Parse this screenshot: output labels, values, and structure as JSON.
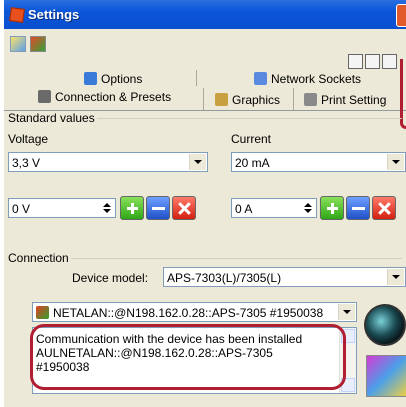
{
  "window": {
    "title": "Settings"
  },
  "tabs": [
    {
      "label": "Options",
      "icon": "options-icon"
    },
    {
      "label": "Network Sockets",
      "icon": "network-sockets-icon"
    },
    {
      "label": "Connection & Presets",
      "icon": "connection-icon"
    },
    {
      "label": "Graphics",
      "icon": "graphics-icon"
    },
    {
      "label": "Print Setting",
      "icon": "print-icon"
    }
  ],
  "standard_values": {
    "group_title": "Standard values",
    "voltage_label": "Voltage",
    "voltage_value": "3,3 V",
    "voltage_spin_value": "0 V",
    "current_label": "Current",
    "current_value": "20 mA",
    "current_spin_value": "0 A"
  },
  "connection": {
    "group_title": "Connection",
    "device_model_label": "Device model:",
    "device_model_value": "APS-7303(L)/7305(L)",
    "device_address": "NETALAN::@N198.162.0.28::APS-7305 #1950038",
    "status_text": "Communication with the device has been installed\nAULNETALAN::@N198.162.0.28::APS-7305\n#1950038"
  },
  "colors": {
    "highlight": "#b11e32",
    "title_bar": "#0a55d8"
  }
}
